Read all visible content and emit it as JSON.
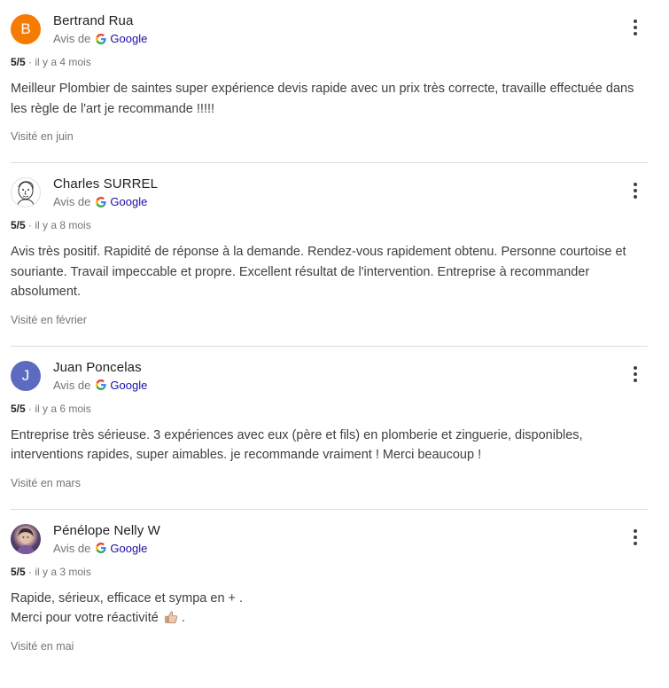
{
  "source_label": "Avis de",
  "source_brand": "Google",
  "reviews": [
    {
      "author": "Bertrand Rua",
      "avatar_letter": "B",
      "avatar_color": "#f57c00",
      "rating": "5/5",
      "time": "il y a 4 mois",
      "text": "Meilleur Plombier de saintes super expérience devis rapide avec un prix très correcte, travaille effectuée dans les règle de l'art je recommande !!!!!",
      "visited": "Visité en juin"
    },
    {
      "author": "Charles SURREL",
      "avatar_letter": "",
      "avatar_color": "#ffffff",
      "rating": "5/5",
      "time": "il y a 8 mois",
      "text": "Avis très positif. Rapidité de réponse à la demande. Rendez-vous rapidement obtenu. Personne courtoise et souriante. Travail impeccable et propre. Excellent résultat de l'intervention. Entreprise à recommander absolument.",
      "visited": "Visité en février"
    },
    {
      "author": "Juan Poncelas",
      "avatar_letter": "J",
      "avatar_color": "#5c6bc0",
      "rating": "5/5",
      "time": "il y a 6 mois",
      "text": "Entreprise très sérieuse. 3 expériences avec eux (père et fils) en plomberie et zinguerie, disponibles, interventions rapides, super aimables. je recommande vraiment ! Merci beaucoup !",
      "visited": "Visité en mars"
    },
    {
      "author": "Pénélope Nelly W",
      "avatar_letter": "",
      "avatar_color": "#6d4c7d",
      "rating": "5/5",
      "time": "il y a 3 mois",
      "text_line1": "Rapide, sérieux, efficace et sympa en + .",
      "text_line2": "Merci pour votre réactivité",
      "text_line2_end": ".",
      "visited": "Visité en mai"
    }
  ]
}
